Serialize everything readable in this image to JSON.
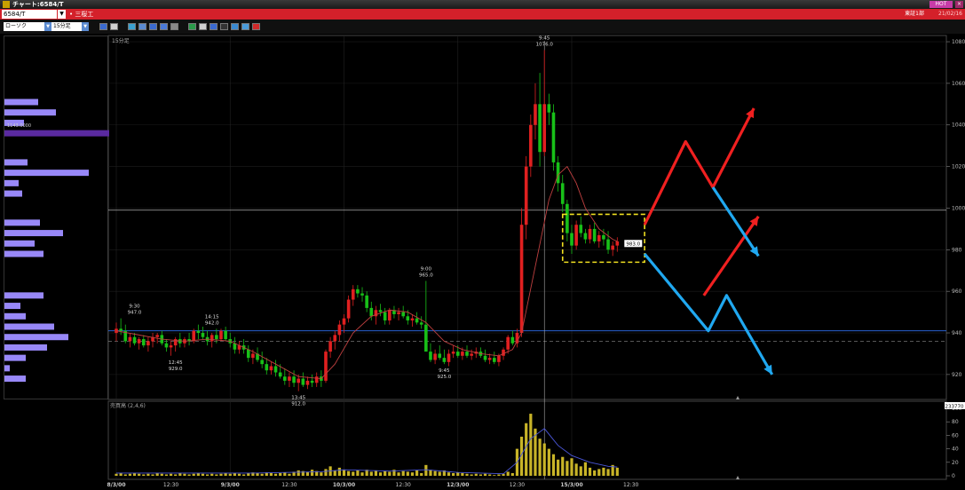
{
  "window": {
    "title": "チャート:6584/T",
    "hot_label": "HOT",
    "close_label": "×"
  },
  "symbol": {
    "code": "6584/T",
    "name": "• 三桜工",
    "market": "東証1部",
    "date": "21/02/16"
  },
  "toolbar": {
    "chart_type": "ローソク",
    "interval": "15分足"
  },
  "colors": {
    "up": "#e02020",
    "down": "#18c018",
    "ma": "#c04040",
    "volume": "#c8b428",
    "volume_ma": "#4a56d8",
    "profile": "#9888f8",
    "profile_highlight": "#5a2aa0",
    "hline_blue": "#2860d0",
    "box": "#f0e020",
    "arrow_red": "#f02020",
    "arrow_blue": "#20a8f0"
  },
  "chart_data": {
    "type": "candlestick",
    "panel_label": "15分足",
    "volume_label": "売買高 (2,4,6)",
    "price_ylim": [
      908,
      1083
    ],
    "y_ticks": [
      920,
      940,
      960,
      980,
      1000,
      1020,
      1040,
      1060,
      1080
    ],
    "volume_ticks": [
      0,
      20,
      40,
      60,
      80,
      100
    ],
    "volume_badge": "233770",
    "x_labels": [
      {
        "i": 0,
        "label": "8/3/00",
        "bold": true
      },
      {
        "i": 12,
        "label": "12:30",
        "bold": false
      },
      {
        "i": 25,
        "label": "9/3/00",
        "bold": true
      },
      {
        "i": 38,
        "label": "12:30",
        "bold": false
      },
      {
        "i": 50,
        "label": "10/3/00",
        "bold": true
      },
      {
        "i": 63,
        "label": "12:30",
        "bold": false
      },
      {
        "i": 75,
        "label": "12/3/00",
        "bold": true
      },
      {
        "i": 88,
        "label": "12:30",
        "bold": false
      },
      {
        "i": 100,
        "label": "15/3/00",
        "bold": true
      },
      {
        "i": 113,
        "label": "12:30",
        "bold": false
      }
    ],
    "candles": [
      [
        0,
        940,
        945,
        936,
        942
      ],
      [
        1,
        942,
        947,
        939,
        941
      ],
      [
        2,
        941,
        944,
        935,
        936
      ],
      [
        3,
        936,
        940,
        933,
        938
      ],
      [
        4,
        938,
        940,
        934,
        935
      ],
      [
        5,
        935,
        938,
        932,
        937
      ],
      [
        6,
        937,
        939,
        933,
        934
      ],
      [
        7,
        934,
        938,
        931,
        936
      ],
      [
        8,
        936,
        940,
        933,
        938
      ],
      [
        9,
        938,
        940,
        935,
        939
      ],
      [
        10,
        939,
        941,
        934,
        935
      ],
      [
        11,
        935,
        937,
        931,
        933
      ],
      [
        12,
        933,
        936,
        929,
        934
      ],
      [
        13,
        934,
        938,
        931,
        937
      ],
      [
        14,
        937,
        940,
        933,
        935
      ],
      [
        15,
        935,
        938,
        933,
        937
      ],
      [
        16,
        937,
        940,
        934,
        936
      ],
      [
        17,
        936,
        942,
        935,
        941
      ],
      [
        18,
        941,
        944,
        937,
        940
      ],
      [
        19,
        940,
        943,
        937,
        938
      ],
      [
        20,
        938,
        941,
        934,
        936
      ],
      [
        21,
        936,
        940,
        933,
        939
      ],
      [
        22,
        939,
        942,
        935,
        937
      ],
      [
        23,
        937,
        942,
        936,
        941
      ],
      [
        24,
        941,
        943,
        936,
        937
      ],
      [
        25,
        937,
        940,
        933,
        935
      ],
      [
        26,
        935,
        938,
        930,
        932
      ],
      [
        27,
        932,
        936,
        930,
        934
      ],
      [
        28,
        934,
        937,
        930,
        932
      ],
      [
        29,
        932,
        934,
        926,
        928
      ],
      [
        30,
        928,
        932,
        925,
        930
      ],
      [
        31,
        930,
        933,
        926,
        927
      ],
      [
        32,
        927,
        931,
        923,
        925
      ],
      [
        33,
        925,
        928,
        920,
        922
      ],
      [
        34,
        922,
        926,
        920,
        924
      ],
      [
        35,
        924,
        927,
        919,
        921
      ],
      [
        36,
        921,
        925,
        918,
        919
      ],
      [
        37,
        919,
        923,
        915,
        917
      ],
      [
        38,
        917,
        921,
        914,
        919
      ],
      [
        39,
        919,
        922,
        914,
        916
      ],
      [
        40,
        916,
        920,
        912,
        918
      ],
      [
        41,
        918,
        921,
        914,
        915
      ],
      [
        42,
        915,
        919,
        913,
        917
      ],
      [
        43,
        917,
        920,
        914,
        916
      ],
      [
        44,
        916,
        921,
        914,
        919
      ],
      [
        45,
        919,
        922,
        914,
        917
      ],
      [
        46,
        917,
        932,
        916,
        931
      ],
      [
        47,
        931,
        938,
        928,
        936
      ],
      [
        48,
        936,
        941,
        932,
        939
      ],
      [
        49,
        939,
        946,
        936,
        944
      ],
      [
        50,
        944,
        949,
        940,
        947
      ],
      [
        51,
        947,
        958,
        945,
        956
      ],
      [
        52,
        956,
        963,
        953,
        961
      ],
      [
        53,
        961,
        963,
        957,
        959
      ],
      [
        54,
        959,
        962,
        955,
        958
      ],
      [
        55,
        958,
        960,
        950,
        952
      ],
      [
        56,
        952,
        955,
        946,
        948
      ],
      [
        57,
        948,
        953,
        944,
        951
      ],
      [
        58,
        951,
        954,
        948,
        950
      ],
      [
        59,
        950,
        952,
        944,
        946
      ],
      [
        60,
        946,
        952,
        944,
        951
      ],
      [
        61,
        951,
        953,
        947,
        949
      ],
      [
        62,
        949,
        952,
        946,
        950
      ],
      [
        63,
        950,
        953,
        947,
        948
      ],
      [
        64,
        948,
        951,
        944,
        946
      ],
      [
        65,
        946,
        949,
        943,
        947
      ],
      [
        66,
        947,
        950,
        944,
        945
      ],
      [
        67,
        945,
        948,
        942,
        944
      ],
      [
        68,
        944,
        965,
        944,
        931
      ],
      [
        69,
        931,
        935,
        926,
        927
      ],
      [
        70,
        927,
        932,
        925,
        930
      ],
      [
        71,
        930,
        934,
        927,
        928
      ],
      [
        72,
        928,
        932,
        925,
        926
      ],
      [
        73,
        926,
        932,
        924,
        930
      ],
      [
        74,
        930,
        934,
        928,
        931
      ],
      [
        75,
        931,
        934,
        928,
        929
      ],
      [
        76,
        929,
        933,
        927,
        931
      ],
      [
        77,
        931,
        934,
        928,
        929
      ],
      [
        78,
        929,
        932,
        927,
        930
      ],
      [
        79,
        930,
        933,
        928,
        931
      ],
      [
        80,
        931,
        933,
        928,
        929
      ],
      [
        81,
        929,
        932,
        926,
        927
      ],
      [
        82,
        927,
        930,
        925,
        928
      ],
      [
        83,
        928,
        931,
        925,
        926
      ],
      [
        84,
        926,
        930,
        924,
        929
      ],
      [
        85,
        929,
        933,
        927,
        932
      ],
      [
        86,
        932,
        939,
        930,
        938
      ],
      [
        87,
        938,
        941,
        934,
        935
      ],
      [
        88,
        935,
        942,
        933,
        940
      ],
      [
        89,
        940,
        1000,
        938,
        992
      ],
      [
        90,
        992,
        1025,
        985,
        1020
      ],
      [
        91,
        1020,
        1045,
        1015,
        1040
      ],
      [
        92,
        1040,
        1060,
        1033,
        1050
      ],
      [
        93,
        1050,
        1065,
        1020,
        1027
      ],
      [
        94,
        1027,
        1076,
        1025,
        1050
      ],
      [
        95,
        1050,
        1055,
        1040,
        1046
      ],
      [
        96,
        1046,
        1050,
        1018,
        1022
      ],
      [
        97,
        1022,
        1025,
        1008,
        1012
      ],
      [
        98,
        1012,
        1016,
        998,
        1002
      ],
      [
        99,
        1002,
        1004,
        984,
        988
      ],
      [
        100,
        988,
        992,
        978,
        982
      ],
      [
        101,
        982,
        994,
        980,
        992
      ],
      [
        102,
        992,
        996,
        986,
        988
      ],
      [
        103,
        988,
        990,
        983,
        985
      ],
      [
        104,
        985,
        992,
        983,
        990
      ],
      [
        105,
        990,
        993,
        983,
        984
      ],
      [
        106,
        984,
        989,
        981,
        987
      ],
      [
        107,
        987,
        990,
        982,
        985
      ],
      [
        108,
        985,
        989,
        978,
        980
      ],
      [
        109,
        980,
        984,
        977,
        982
      ],
      [
        110,
        982,
        986,
        979,
        984
      ]
    ],
    "volume": [
      3,
      4,
      2,
      3,
      4,
      3,
      2,
      3,
      2,
      4,
      3,
      2,
      3,
      2,
      4,
      3,
      2,
      3,
      4,
      3,
      2,
      3,
      2,
      3,
      4,
      3,
      4,
      3,
      2,
      4,
      5,
      4,
      3,
      5,
      4,
      3,
      4,
      5,
      3,
      6,
      8,
      7,
      6,
      9,
      7,
      5,
      10,
      14,
      8,
      12,
      9,
      7,
      6,
      8,
      5,
      9,
      6,
      8,
      5,
      7,
      6,
      9,
      5,
      7,
      6,
      5,
      8,
      4,
      16,
      9,
      7,
      6,
      8,
      5,
      4,
      5,
      4,
      3,
      2,
      3,
      2,
      3,
      2,
      1,
      2,
      3,
      6,
      4,
      40,
      58,
      78,
      92,
      70,
      55,
      48,
      40,
      32,
      24,
      28,
      22,
      26,
      18,
      14,
      20,
      12,
      8,
      10,
      12,
      10,
      16,
      12
    ],
    "price_ma": [
      [
        0,
        941
      ],
      [
        5,
        939
      ],
      [
        10,
        937
      ],
      [
        15,
        936
      ],
      [
        20,
        937
      ],
      [
        25,
        936
      ],
      [
        30,
        931
      ],
      [
        35,
        925
      ],
      [
        40,
        919
      ],
      [
        45,
        918
      ],
      [
        48,
        925
      ],
      [
        52,
        940
      ],
      [
        56,
        948
      ],
      [
        60,
        951
      ],
      [
        64,
        950
      ],
      [
        68,
        945
      ],
      [
        72,
        936
      ],
      [
        76,
        932
      ],
      [
        80,
        930
      ],
      [
        84,
        929
      ],
      [
        87,
        932
      ],
      [
        89,
        940
      ],
      [
        92,
        972
      ],
      [
        95,
        1004
      ],
      [
        97,
        1016
      ],
      [
        99,
        1020
      ],
      [
        101,
        1012
      ],
      [
        103,
        1000
      ],
      [
        106,
        990
      ],
      [
        109,
        985
      ],
      [
        110,
        984
      ]
    ],
    "volume_ma": [
      [
        0,
        4
      ],
      [
        30,
        4
      ],
      [
        45,
        6
      ],
      [
        50,
        9
      ],
      [
        60,
        7
      ],
      [
        68,
        9
      ],
      [
        75,
        5
      ],
      [
        85,
        3
      ],
      [
        88,
        20
      ],
      [
        91,
        55
      ],
      [
        94,
        70
      ],
      [
        97,
        45
      ],
      [
        100,
        30
      ],
      [
        104,
        20
      ],
      [
        108,
        14
      ],
      [
        110,
        13
      ]
    ],
    "annotations": [
      {
        "i": 4,
        "price": 947,
        "time": "9:30",
        "value": "947.0",
        "pos": "above"
      },
      {
        "i": 21,
        "price": 942,
        "time": "14:15",
        "value": "942.0",
        "pos": "above"
      },
      {
        "i": 13,
        "price": 929,
        "time": "12:45",
        "value": "929.0",
        "pos": "below"
      },
      {
        "i": 40,
        "price": 912,
        "time": "13:45",
        "value": "912.0",
        "pos": "below"
      },
      {
        "i": 68,
        "price": 965,
        "time": "9:00",
        "value": "965.0",
        "pos": "above"
      },
      {
        "i": 72,
        "price": 925,
        "time": "9:45",
        "value": "925.0",
        "pos": "below"
      },
      {
        "i": 94,
        "price": 1076,
        "time": "9:45",
        "value": "1076.0",
        "pos": "above"
      }
    ],
    "hline_white_price": 999,
    "hline_blue_price": 941,
    "hline_dash_price": 936,
    "vline_i": 94,
    "current_price": "983.0",
    "left_label": "1143.0000",
    "volume_profile": [
      {
        "price": 1051,
        "value": 38
      },
      {
        "price": 1046,
        "value": 58
      },
      {
        "price": 1041,
        "value": 22
      },
      {
        "price": 1036,
        "value": 118,
        "highlight": true
      },
      {
        "price": 1022,
        "value": 26
      },
      {
        "price": 1017,
        "value": 95
      },
      {
        "price": 1012,
        "value": 16
      },
      {
        "price": 1007,
        "value": 20
      },
      {
        "price": 993,
        "value": 40
      },
      {
        "price": 988,
        "value": 66
      },
      {
        "price": 983,
        "value": 34
      },
      {
        "price": 978,
        "value": 44
      },
      {
        "price": 958,
        "value": 44
      },
      {
        "price": 953,
        "value": 18
      },
      {
        "price": 948,
        "value": 24
      },
      {
        "price": 943,
        "value": 56
      },
      {
        "price": 938,
        "value": 72
      },
      {
        "price": 933,
        "value": 48
      },
      {
        "price": 928,
        "value": 24
      },
      {
        "price": 923,
        "value": 6
      },
      {
        "price": 918,
        "value": 24
      }
    ],
    "box": {
      "i_start": 98,
      "i_end": 116,
      "price_top": 997,
      "price_bottom": 974
    },
    "arrows_red": [
      [
        [
          116,
          992
        ],
        [
          125,
          1032
        ],
        [
          131,
          1010
        ],
        [
          140,
          1048
        ]
      ],
      [
        [
          129,
          958
        ],
        [
          141,
          996
        ]
      ]
    ],
    "arrows_blue": [
      [
        [
          116,
          978
        ],
        [
          130,
          941
        ],
        [
          134,
          958
        ],
        [
          144,
          920
        ]
      ],
      [
        [
          131,
          1010
        ],
        [
          141,
          977
        ]
      ]
    ]
  }
}
